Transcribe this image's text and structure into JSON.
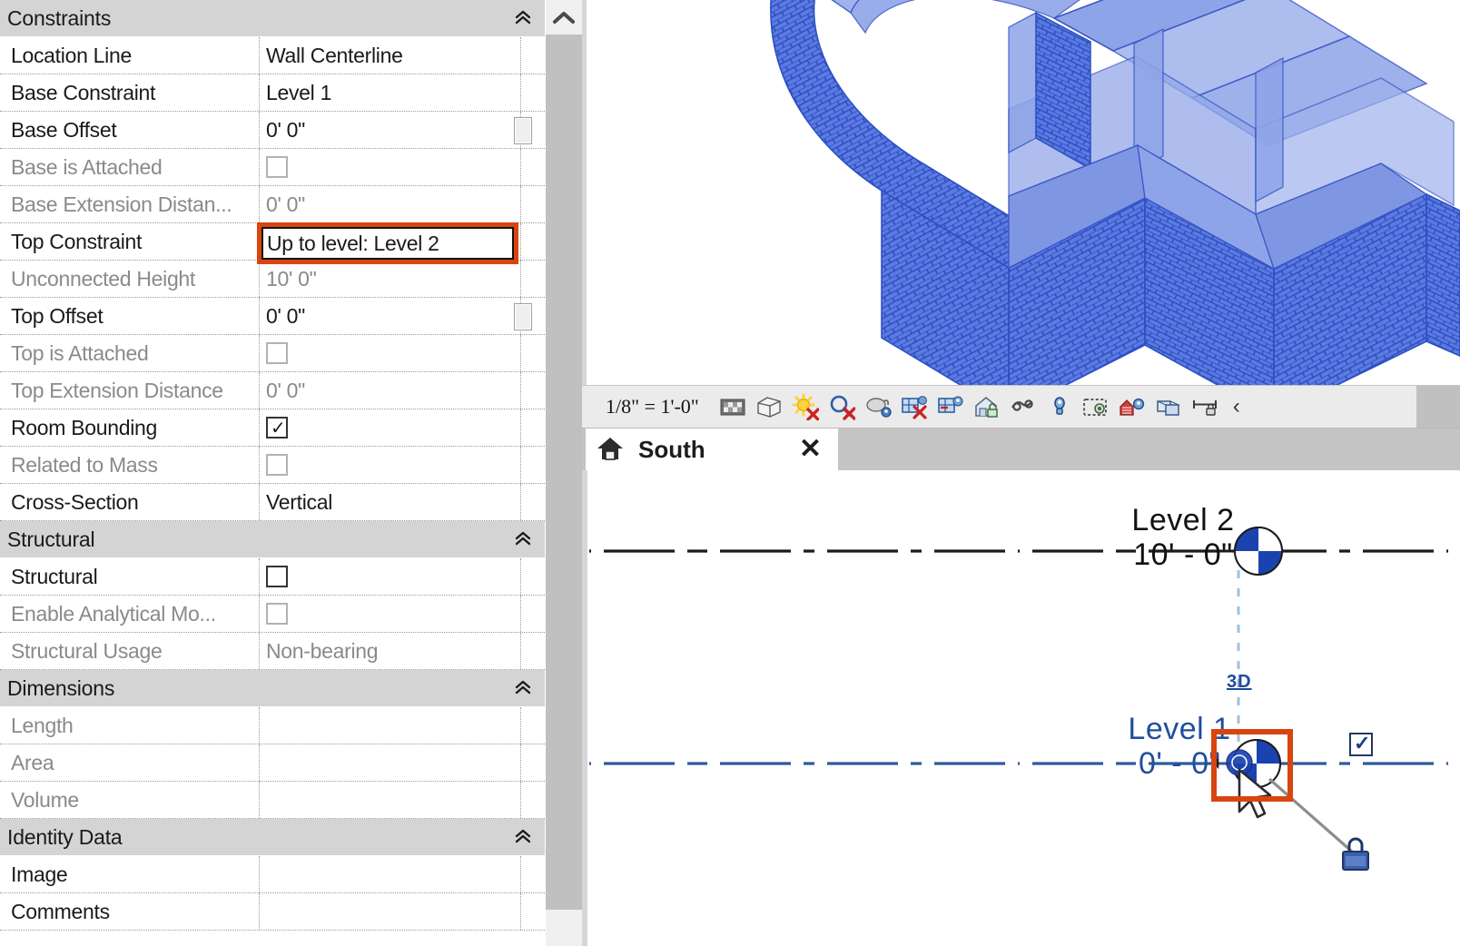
{
  "properties_panel": {
    "groups": [
      {
        "name": "Constraints",
        "collapse_icon": "double-chevron-up-icon",
        "rows": [
          {
            "label": "Location Line",
            "value": "Wall Centerline",
            "type": "text",
            "dim": false,
            "spin": false
          },
          {
            "label": "Base Constraint",
            "value": "Level 1",
            "type": "text",
            "dim": false,
            "spin": false
          },
          {
            "label": "Base Offset",
            "value": "0'  0\"",
            "type": "text",
            "dim": false,
            "spin": true
          },
          {
            "label": "Base is Attached",
            "value": "",
            "type": "checkbox",
            "dim": true,
            "checked": false
          },
          {
            "label": "Base Extension Distan...",
            "value": "0'  0\"",
            "type": "text",
            "dim": true,
            "spin": false
          },
          {
            "label": "Top Constraint",
            "value": "Up to level: Level 2",
            "type": "highlighted",
            "dim": false,
            "spin": false
          },
          {
            "label": "Unconnected Height",
            "value": "10'  0\"",
            "type": "text",
            "dim": true,
            "spin": false
          },
          {
            "label": "Top Offset",
            "value": "0'  0\"",
            "type": "text",
            "dim": false,
            "spin": true
          },
          {
            "label": "Top is Attached",
            "value": "",
            "type": "checkbox",
            "dim": true,
            "checked": false
          },
          {
            "label": "Top Extension Distance",
            "value": "0'  0\"",
            "type": "text",
            "dim": true,
            "spin": false
          },
          {
            "label": "Room Bounding",
            "value": "",
            "type": "checkbox",
            "dim": false,
            "checked": true
          },
          {
            "label": "Related to Mass",
            "value": "",
            "type": "checkbox",
            "dim": true,
            "checked": false
          },
          {
            "label": "Cross-Section",
            "value": "Vertical",
            "type": "text",
            "dim": false,
            "spin": false
          }
        ]
      },
      {
        "name": "Structural",
        "collapse_icon": "double-chevron-up-icon",
        "rows": [
          {
            "label": "Structural",
            "value": "",
            "type": "checkbox",
            "dim": false,
            "checked": false
          },
          {
            "label": "Enable Analytical Mo...",
            "value": "",
            "type": "checkbox",
            "dim": true,
            "checked": false
          },
          {
            "label": "Structural Usage",
            "value": "Non-bearing",
            "type": "text",
            "dim": true,
            "spin": false
          }
        ]
      },
      {
        "name": "Dimensions",
        "collapse_icon": "double-chevron-up-icon",
        "rows": [
          {
            "label": "Length",
            "value": "",
            "type": "text",
            "dim": true,
            "spin": false
          },
          {
            "label": "Area",
            "value": "",
            "type": "text",
            "dim": true,
            "spin": false
          },
          {
            "label": "Volume",
            "value": "",
            "type": "text",
            "dim": true,
            "spin": false
          }
        ]
      },
      {
        "name": "Identity Data",
        "collapse_icon": "double-chevron-up-icon",
        "rows": [
          {
            "label": "Image",
            "value": "",
            "type": "text",
            "dim": false,
            "spin": false
          },
          {
            "label": "Comments",
            "value": "",
            "type": "text",
            "dim": false,
            "spin": false
          }
        ]
      }
    ],
    "scrollbar": {
      "up_icon": "chevron-up-icon"
    }
  },
  "view_control_bar": {
    "scale": "1/8\" = 1'-0\"",
    "icons": [
      "detail-level-icon",
      "visual-style-icon",
      "sun-path-off-icon",
      "shadows-off-icon",
      "rendering-dialog-icon",
      "crop-region-off-icon",
      "show-crop-region-icon",
      "unlocked-3d-view-icon",
      "temporary-hide-isolate-icon",
      "reveal-hidden-elements-icon",
      "temporary-view-properties-icon",
      "hide-analytical-model-icon",
      "reveal-constraints-icon",
      "measure-icon"
    ],
    "collapse_label": "‹"
  },
  "view_tab": {
    "icon": "home-view-icon",
    "label": "South",
    "close_label": "✕"
  },
  "elevation_view": {
    "levels": [
      {
        "name": "Level 2",
        "elevation": "10' - 0\"",
        "selected": false,
        "color": "#111111"
      },
      {
        "name": "Level 1",
        "elevation": "0' - 0\"",
        "selected": true,
        "color": "#1f4f9c"
      }
    ],
    "tag_3d": "3D",
    "level_head_icon": "level-bubble-icon",
    "lock_icon": "padlock-closed-icon",
    "constraint_checkbox": {
      "icon": "checkbox-checked-icon",
      "checked": true
    },
    "cursor_icon": "arrow-cursor-icon",
    "selection_highlight_color": "#d8450f"
  },
  "model_view_3d": {
    "element": "brick-wall-assembly",
    "fill_color": "#7f96e3",
    "hatch_color": "#2b4fc4",
    "description": "Selected brick walls shown in blue with running-bond hatch"
  },
  "colors": {
    "highlight": "#d8450f",
    "selection_blue": "#1f4f9c",
    "panel_header_gray": "#d4d4d4",
    "wall_blue": "#4a68d8"
  }
}
